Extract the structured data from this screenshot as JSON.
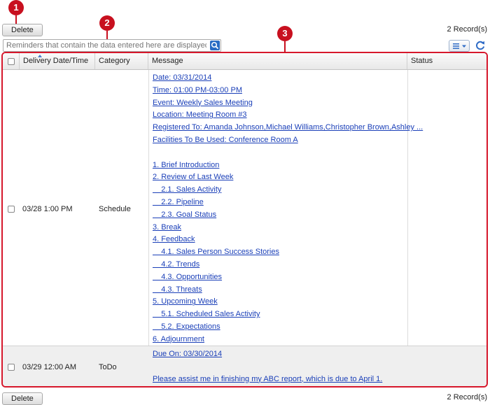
{
  "toolbar_top": {
    "delete_label": "Delete",
    "record_count": "2 Record(s)"
  },
  "search": {
    "placeholder": "Reminders that contain the data entered here are displayed."
  },
  "callouts": [
    "1",
    "2",
    "3"
  ],
  "columns": {
    "delivery": "Delivery Date/Time",
    "category": "Category",
    "message": "Message",
    "status": "Status"
  },
  "rows": [
    {
      "delivery": "03/28 1:00 PM",
      "category": "Schedule",
      "status": "",
      "message_lines": [
        "Date: 03/31/2014",
        "Time: 01:00 PM-03:00 PM",
        "Event: Weekly Sales Meeting",
        "Location: Meeting Room #3",
        "Registered To: Amanda Johnson,Michael Williams,Christopher Brown,Ashley ...",
        "Facilities To Be Used: Conference Room A",
        "",
        "1. Brief Introduction",
        "2. Review of Last Week",
        "    2.1. Sales Activity",
        "    2.2. Pipeline",
        "    2.3. Goal Status",
        "3. Break",
        "4. Feedback",
        "    4.1. Sales Person Success Stories",
        "    4.2. Trends",
        "    4.3. Opportunities",
        "    4.3. Threats",
        "5. Upcoming Week",
        "    5.1. Scheduled Sales Activity",
        "    5.2. Expectations",
        "6. Adjournment"
      ]
    },
    {
      "delivery": "03/29 12:00 AM",
      "category": "ToDo",
      "status": "",
      "message_lines": [
        "Due On: 03/30/2014",
        "",
        "Please assist me in finishing my ABC report, which is due to April 1."
      ]
    }
  ],
  "toolbar_bottom": {
    "delete_label": "Delete",
    "record_count": "2 Record(s)"
  },
  "colors": {
    "callout": "#c8101f",
    "link": "#1a3fb8",
    "frame": "#d6172b"
  },
  "icons": [
    "search-icon",
    "list-view-icon",
    "refresh-icon",
    "sort-ascending-icon"
  ]
}
